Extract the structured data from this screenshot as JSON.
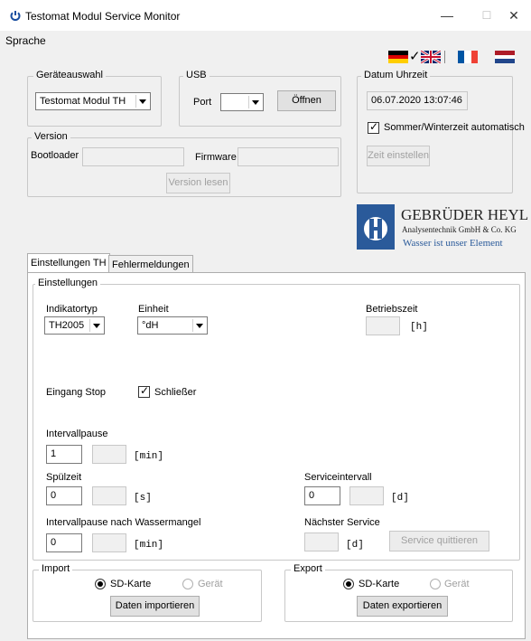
{
  "window": {
    "title": "Testomat Modul Service Monitor",
    "minimize_glyph": "—",
    "maximize_glyph": "☐",
    "close_glyph": "✕"
  },
  "menu": {
    "sprache": "Sprache"
  },
  "geraeteauswahl": {
    "legend": "Geräteauswahl",
    "selected": "Testomat Modul TH"
  },
  "usb": {
    "legend": "USB",
    "port_label": "Port",
    "port_value": "",
    "open_button": "Öffnen"
  },
  "datum": {
    "legend": "Datum Uhrzeit",
    "value": "06.07.2020  13:07:46",
    "dst_label": "Sommer/Winterzeit automatisch",
    "set_button": "Zeit einstellen"
  },
  "version": {
    "legend": "Version",
    "bootloader_label": "Bootloader",
    "firmware_label": "Firmware",
    "read_button": "Version lesen"
  },
  "logo": {
    "name": "GEBRÜDER HEYL",
    "sub": "Analysentechnik GmbH & Co. KG",
    "slogan": "Wasser ist unser Element",
    "accent": "#2a5a9a"
  },
  "flags": [
    "german-flag",
    "uk-flag",
    "french-flag",
    "dutch-flag"
  ],
  "tabs": [
    {
      "label": "Einstellungen TH",
      "active": true
    },
    {
      "label": "Fehlermeldungen",
      "active": false
    }
  ],
  "einstellungen": {
    "legend": "Einstellungen",
    "indikatortyp_label": "Indikatortyp",
    "indikatortyp_value": "TH2005",
    "einheit_label": "Einheit",
    "einheit_value": "°dH",
    "betriebszeit_label": "Betriebszeit",
    "betriebszeit_unit": "[h]",
    "eingang_stop_label": "Eingang Stop",
    "schliesser_label": "Schließer",
    "intervallpause_label": "Intervallpause",
    "intervallpause_value": "1",
    "intervallpause_unit": "[min]",
    "spuelzeit_label": "Spülzeit",
    "spuelzeit_value": "0",
    "spuelzeit_unit": "[s]",
    "serviceintervall_label": "Serviceintervall",
    "serviceintervall_value": "0",
    "serviceintervall_unit": "[d]",
    "wassermangel_label": "Intervallpause nach Wassermangel",
    "wassermangel_value": "0",
    "wassermangel_unit": "[min]",
    "naechster_service_label": "Nächster Service",
    "naechster_service_unit": "[d]",
    "service_button": "Service quittieren"
  },
  "import": {
    "legend": "Import",
    "sd_label": "SD-Karte",
    "geraet_label": "Gerät",
    "button": "Daten importieren"
  },
  "export": {
    "legend": "Export",
    "sd_label": "SD-Karte",
    "geraet_label": "Gerät",
    "button": "Daten exportieren"
  }
}
